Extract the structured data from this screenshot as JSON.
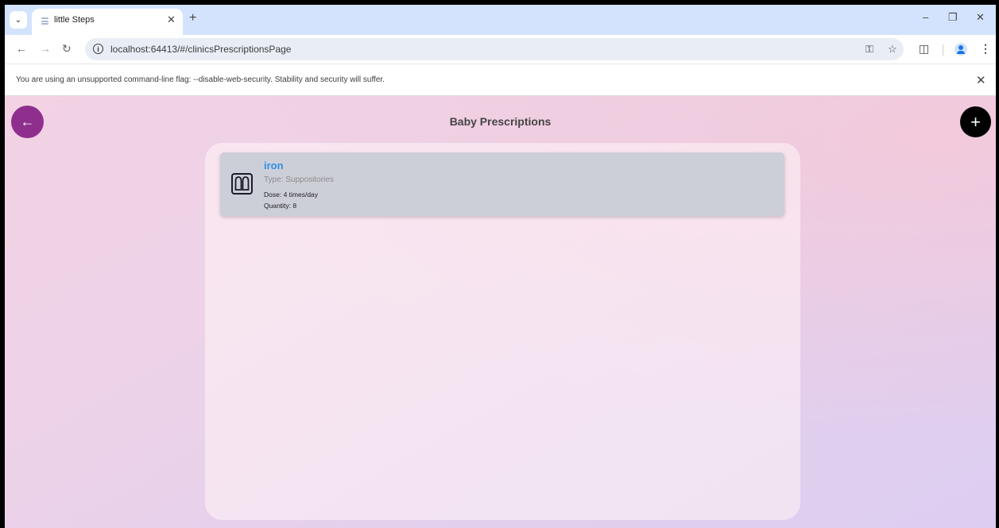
{
  "browser": {
    "tab_menu_icon": "chevron-down-icon",
    "tab_title": "little Steps",
    "tab_close": "✕",
    "new_tab": "+",
    "url": "localhost:64413/#/clinicsPrescriptionsPage",
    "window_controls": {
      "minimize": "–",
      "maximize": "❐",
      "close": "✕"
    }
  },
  "infobar": {
    "message": "You are using an unsupported command-line flag: --disable-web-security. Stability and security will suffer.",
    "close": "✕"
  },
  "app": {
    "title": "Baby Prescriptions",
    "back_icon": "←",
    "add_icon": "+",
    "accent_color": "#8e2f8e",
    "prescriptions": [
      {
        "name": "iron",
        "type": "Type: Suppositories",
        "dose": "Dose: 4 times/day",
        "quantity": "Quantity: 8",
        "icon": "suppository-icon"
      }
    ]
  }
}
